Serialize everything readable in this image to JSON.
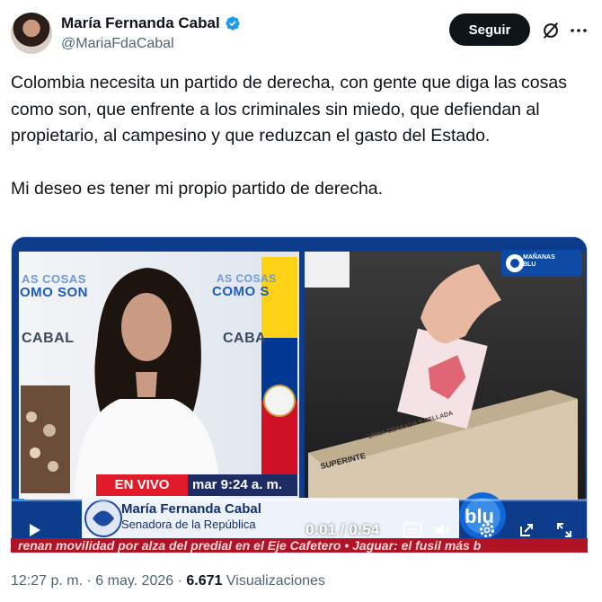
{
  "author": {
    "display_name": "María Fernanda Cabal",
    "handle": "@MariaFdaCabal",
    "follow_label": "Seguir"
  },
  "tweet": {
    "paragraph_1": "Colombia necesita un partido de derecha, con gente que diga las cosas como son, que enfrente a los criminales sin miedo, que defiendan al propietario, al campesino y que reduzcan el gasto del Estado.",
    "paragraph_2": "Mi deseo es tener mi propio partido de derecha."
  },
  "video": {
    "time_display": "0:01 / 0:54",
    "live_label": "EN VIVO",
    "clock_label": "mar   9:24 a. m.",
    "lower_third_name": "María Fernanda Cabal",
    "lower_third_role": "Senadora de la República",
    "ticker_text": "renan movilidad por alza del predial en el Eje Cafetero  •  Jaguar: el fusil más b",
    "backdrop_lines": [
      "AS COSAS",
      "OMO SON",
      "CABAL",
      "AS COSAS",
      "COMO S",
      "CABA"
    ],
    "channel_badge": "MAÑANAS BLU",
    "channel_logo": "blu",
    "ballot_box_text": "URNA CERRADA Y SELLADA",
    "ballot_box_label": "SUPERINTE"
  },
  "meta": {
    "time": "12:27 p. m.",
    "separator": "·",
    "date": "6 may. 2026",
    "views_count": "6.671",
    "views_label": "Visualizaciones"
  },
  "colors": {
    "follow_bg": "#0f1419",
    "verified": "#1d9bf0",
    "live_red": "#e21b2a",
    "ticker_red": "#b01226"
  }
}
